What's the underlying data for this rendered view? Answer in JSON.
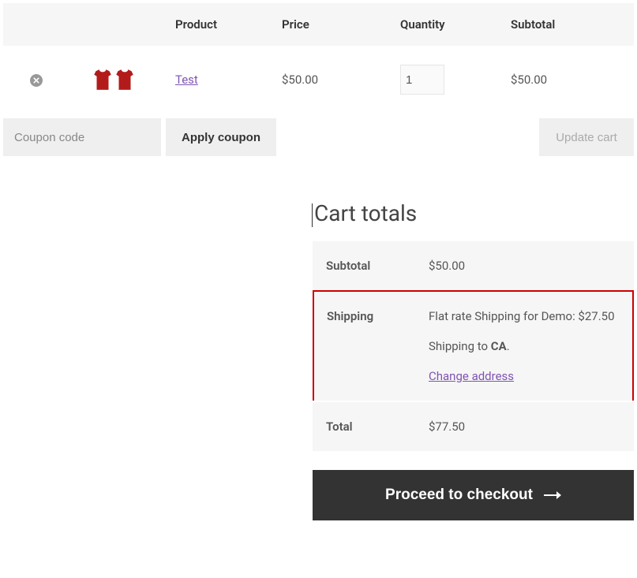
{
  "cart": {
    "headers": {
      "product": "Product",
      "price": "Price",
      "quantity": "Quantity",
      "subtotal": "Subtotal"
    },
    "items": [
      {
        "name": "Test",
        "price": "$50.00",
        "quantity": "1",
        "subtotal": "$50.00"
      }
    ],
    "coupon": {
      "placeholder": "Coupon code",
      "apply_label": "Apply coupon"
    },
    "update_label": "Update cart"
  },
  "totals": {
    "title": "Cart totals",
    "rows": {
      "subtotal_label": "Subtotal",
      "subtotal_value": "$50.00",
      "shipping_label": "Shipping",
      "shipping_method": "Flat rate Shipping for Demo: $27.50",
      "shipping_to_prefix": "Shipping to ",
      "shipping_to_region": "CA",
      "shipping_to_suffix": ".",
      "change_address": "Change address",
      "total_label": "Total",
      "total_value": "$77.50"
    },
    "checkout_label": "Proceed to checkout"
  }
}
